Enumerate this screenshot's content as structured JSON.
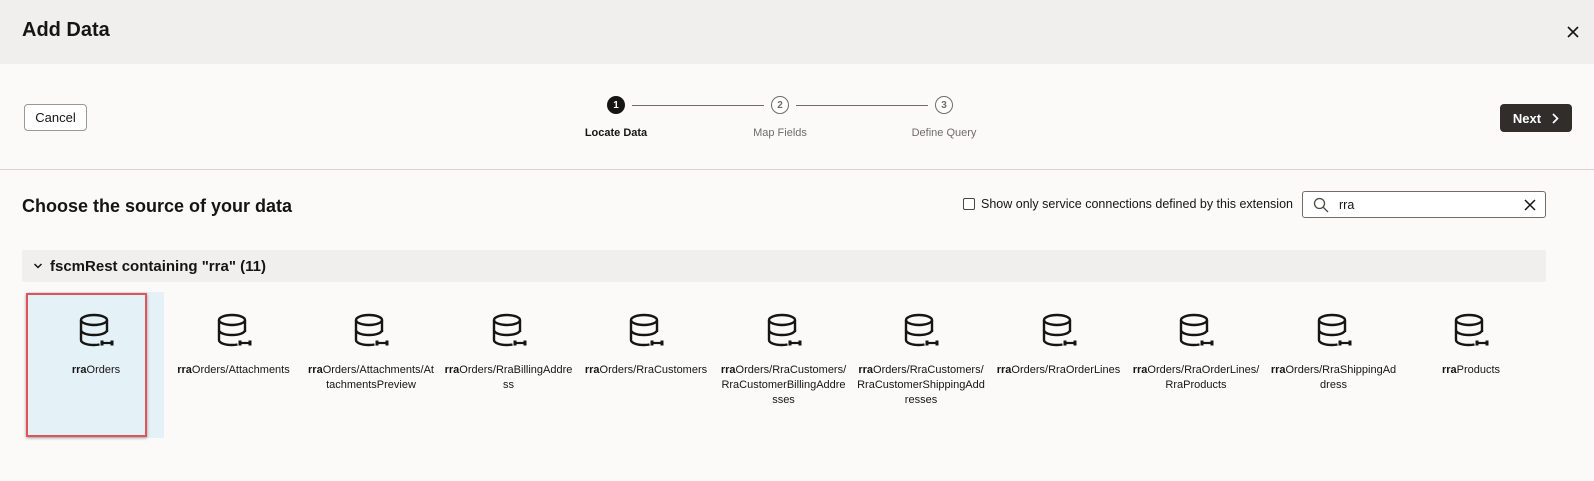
{
  "dialog": {
    "title": "Add Data"
  },
  "toolbar": {
    "cancel_label": "Cancel",
    "next_label": "Next"
  },
  "steps": [
    {
      "number": "1",
      "label": "Locate Data",
      "state": "active"
    },
    {
      "number": "2",
      "label": "Map Fields",
      "state": "inactive"
    },
    {
      "number": "3",
      "label": "Define Query",
      "state": "inactive"
    }
  ],
  "main": {
    "heading": "Choose the source of your data",
    "filter_checkbox_label": "Show only service connections defined by this extension",
    "filter_checked": false,
    "search": {
      "value": "rra",
      "placeholder": ""
    }
  },
  "group": {
    "label": "fscmRest containing \"rra\" (11)",
    "expanded": true
  },
  "tiles": [
    {
      "label_bold": "rra",
      "label_rest": "Orders",
      "selected": true
    },
    {
      "label_bold": "rra",
      "label_rest": "Orders/Attachments",
      "selected": false
    },
    {
      "label_bold": "rra",
      "label_rest": "Orders/Attachments/AttachmentsPreview",
      "selected": false
    },
    {
      "label_bold": "rra",
      "label_rest": "Orders/RraBillingAddress",
      "selected": false
    },
    {
      "label_bold": "rra",
      "label_rest": "Orders/RraCustomers",
      "selected": false
    },
    {
      "label_bold": "rra",
      "label_rest": "Orders/RraCustomers/RraCustomerBillingAddresses",
      "selected": false
    },
    {
      "label_bold": "rra",
      "label_rest": "Orders/RraCustomers/RraCustomerShippingAddresses",
      "selected": false
    },
    {
      "label_bold": "rra",
      "label_rest": "Orders/RraOrderLines",
      "selected": false
    },
    {
      "label_bold": "rra",
      "label_rest": "Orders/RraOrderLines/RraProducts",
      "selected": false
    },
    {
      "label_bold": "rra",
      "label_rest": "Orders/RraShippingAddress",
      "selected": false
    },
    {
      "label_bold": "rra",
      "label_rest": "Products",
      "selected": false
    }
  ],
  "icons": {
    "tile_icon": "database-icon",
    "close": "close-icon",
    "search": "search-icon",
    "clear": "clear-icon",
    "chevron": "chevron-down-icon",
    "next_arrow": "chevron-right-icon"
  },
  "colors": {
    "primary_button": "#312d2a",
    "selected_tile": "#e4f1f7",
    "highlight_border": "#e05457"
  }
}
